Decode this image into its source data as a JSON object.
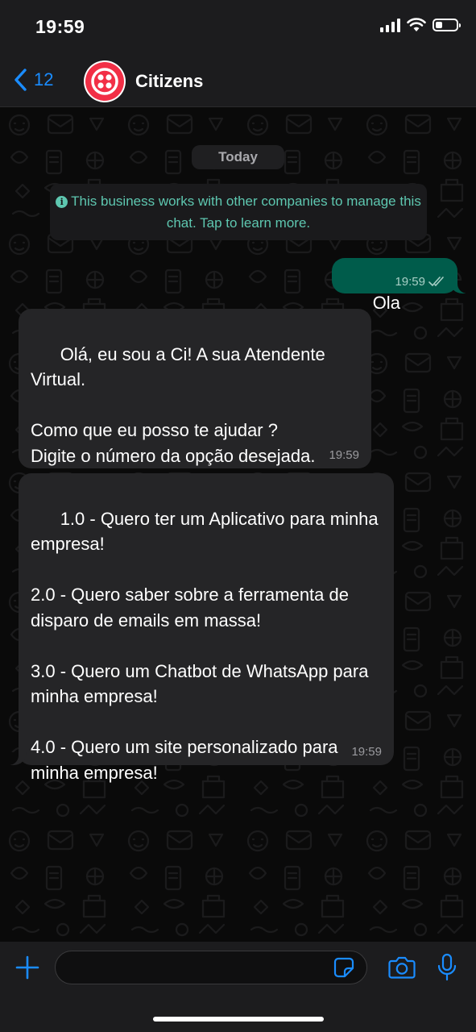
{
  "status_bar": {
    "time": "19:59",
    "battery_level": 0.35
  },
  "header": {
    "back_count": "12",
    "contact_name": "Citizens",
    "avatar_color": "#f22f46"
  },
  "chat": {
    "date_label": "Today",
    "business_notice": "This business works with other companies to manage this chat. Tap to learn more.",
    "messages": [
      {
        "direction": "outgoing",
        "text": "Ola",
        "time": "19:59",
        "status": "read"
      },
      {
        "direction": "incoming",
        "text": "Olá, eu sou a Ci! A sua Atendente Virtual.\n\nComo que eu posso te ajudar ?\nDigite o número da opção desejada.",
        "time": "19:59"
      },
      {
        "direction": "incoming",
        "text": "1.0 - Quero ter um Aplicativo para minha empresa!\n\n2.0 - Quero saber sobre a ferramenta de disparo de emails em massa!\n\n3.0 - Quero um Chatbot de WhatsApp para minha empresa!\n\n4.0 - Quero um site personalizado para minha empresa!",
        "time": "19:59"
      }
    ]
  },
  "input_bar": {
    "message_value": "",
    "icons": [
      "plus-icon",
      "sticker-icon",
      "camera-icon",
      "microphone-icon"
    ]
  },
  "colors": {
    "accent": "#1a8cff",
    "outgoing_bubble": "#005c4b",
    "incoming_bubble": "#252527",
    "notice_text": "#5ec7b0"
  }
}
